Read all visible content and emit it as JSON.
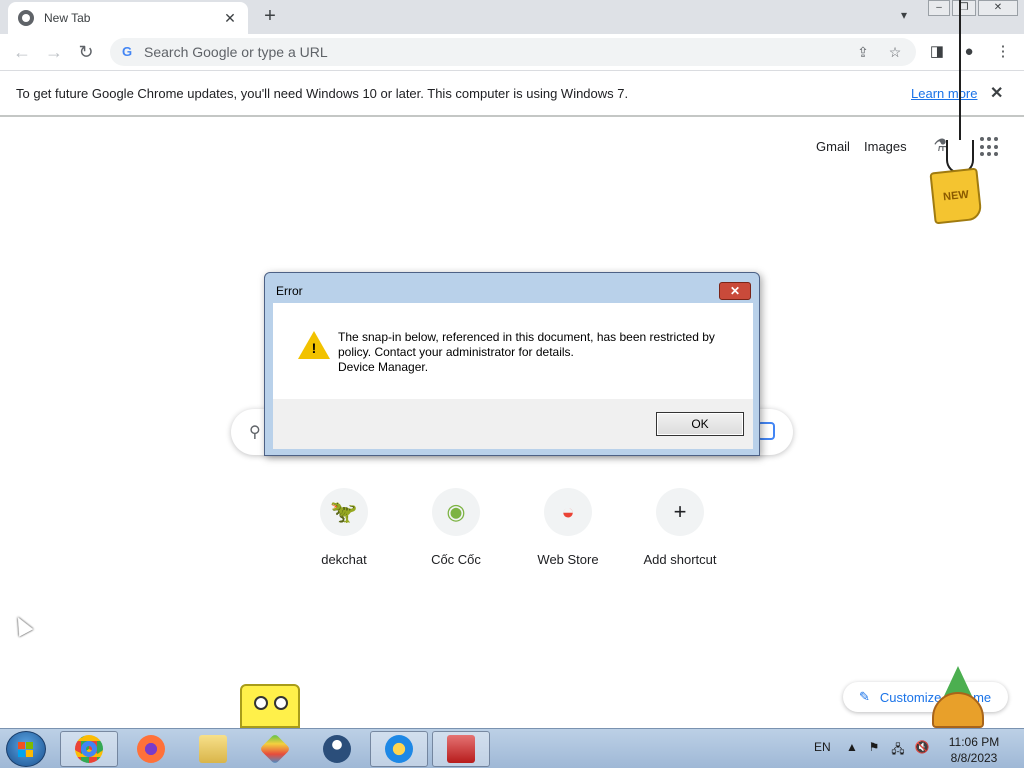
{
  "browser": {
    "tab_title": "New Tab",
    "new_tab_symbol": "+",
    "omnibox_placeholder": "Search Google or type a URL",
    "google_g": "G"
  },
  "infobar": {
    "message": "To get future Google Chrome updates, you'll need Windows 10 or later. This computer is using Windows 7.",
    "learn_more": "Learn more"
  },
  "ntp": {
    "gmail": "Gmail",
    "images": "Images",
    "shortcuts": [
      {
        "label": "dekchat",
        "icon": "dekchat-icon"
      },
      {
        "label": "Cốc Cốc",
        "icon": "coccoc-icon"
      },
      {
        "label": "Web Store",
        "icon": "webstore-icon"
      },
      {
        "label": "Add shortcut",
        "icon": "plus-icon"
      }
    ],
    "customize_label": "Customize Chrome"
  },
  "decoration": {
    "new_tag": "NEW"
  },
  "dialog": {
    "title": "Error",
    "message_line1": "The snap-in below, referenced in this document, has been restricted by",
    "message_line2": "policy. Contact your administrator for details.",
    "message_line3": "Device Manager.",
    "ok_label": "OK"
  },
  "taskbar": {
    "apps": [
      "chrome-icon",
      "firefox-icon",
      "file-explorer-icon",
      "bluestacks-icon",
      "vpn-icon",
      "game-icon",
      "toolbox-icon"
    ],
    "language": "EN",
    "time": "11:06 PM",
    "date": "8/8/2023"
  },
  "colors": {
    "chrome_accent": "#1a73e8",
    "taskbar": "#9fb8d6",
    "dialog_frame": "#b9d1ea",
    "warning": "#f2c200"
  }
}
